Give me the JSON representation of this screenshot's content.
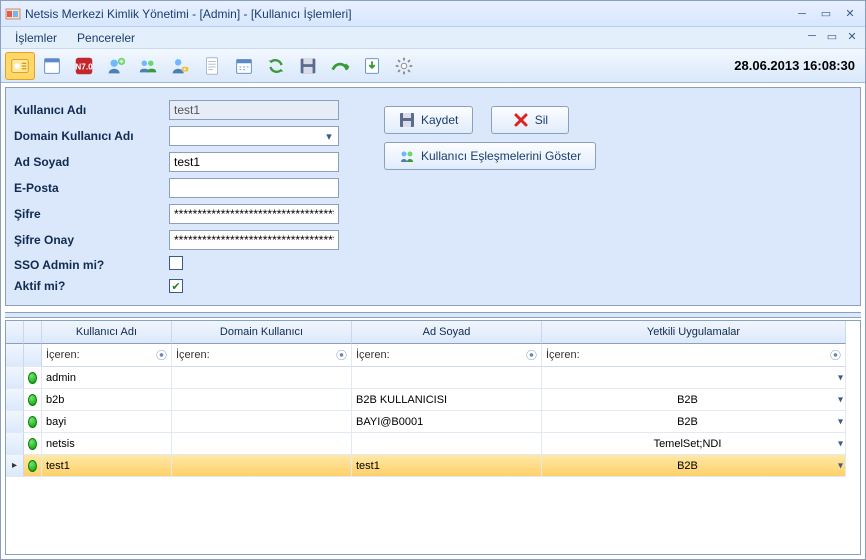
{
  "window": {
    "title": "Netsis Merkezi Kimlik Yönetimi - [Admin] - [Kullanıcı İşlemleri]"
  },
  "menu": {
    "islemler": "İşlemler",
    "pencereler": "Pencereler"
  },
  "timestamp": "28.06.2013 16:08:30",
  "form": {
    "kullanici_adi_label": "Kullanıcı Adı",
    "kullanici_adi": "test1",
    "domain_label": "Domain Kullanıcı Adı",
    "domain": "",
    "ad_soyad_label": "Ad Soyad",
    "ad_soyad": "test1",
    "eposta_label": "E-Posta",
    "eposta": "",
    "sifre_label": "Şifre",
    "sifre": "************************************",
    "sifre_onay_label": "Şifre Onay",
    "sifre_onay": "************************************",
    "sso_label": "SSO Admin mi?",
    "sso": false,
    "aktif_label": "Aktif mi?",
    "aktif": true
  },
  "buttons": {
    "kaydet": "Kaydet",
    "sil": "Sil",
    "eslesme": "Kullanıcı Eşleşmelerini Göster"
  },
  "grid": {
    "headers": {
      "kullanici": "Kullanıcı Adı",
      "domain": "Domain Kullanıcı",
      "adsoyad": "Ad Soyad",
      "yetkili": "Yetkili Uygulamalar"
    },
    "filter_label": "İçeren:",
    "rows": [
      {
        "kullanici": "admin",
        "domain": "",
        "adsoyad": "",
        "yetkili": "",
        "selected": false
      },
      {
        "kullanici": "b2b",
        "domain": "",
        "adsoyad": "B2B KULLANICISI",
        "yetkili": "B2B",
        "selected": false
      },
      {
        "kullanici": "bayi",
        "domain": "",
        "adsoyad": "BAYI@B0001",
        "yetkili": "B2B",
        "selected": false
      },
      {
        "kullanici": "netsis",
        "domain": "",
        "adsoyad": "",
        "yetkili": "TemelSet;NDI",
        "selected": false
      },
      {
        "kullanici": "test1",
        "domain": "",
        "adsoyad": "test1",
        "yetkili": "B2B",
        "selected": true
      }
    ]
  }
}
